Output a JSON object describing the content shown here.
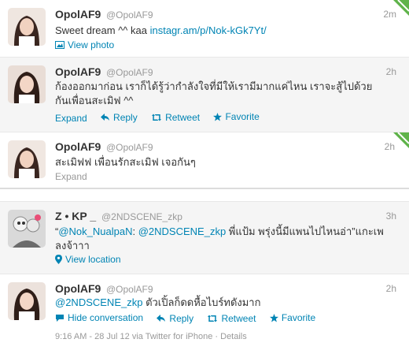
{
  "tweets": [
    {
      "fullname": "OpolAF9",
      "screenname": "@OpolAF9",
      "time": "2m",
      "text": "Sweet dream ^^ kaa ",
      "link": "instagr.am/p/Nok-kGk7Yt/",
      "view_photo": "View photo"
    },
    {
      "fullname": "OpolAF9",
      "screenname": "@OpolAF9",
      "time": "2h",
      "text": "ก้องออกมาก่อน เราก็ได้รู้ว่ากำลังใจที่มีให้เรามีมากแค่ไหน เราจะสู้ไปด้วยกันเพื่อนสะเมิฟ ^^",
      "expand": "Expand",
      "reply": "Reply",
      "retweet": "Retweet",
      "favorite": "Favorite"
    },
    {
      "fullname": "OpolAF9",
      "screenname": "@OpolAF9",
      "time": "2h",
      "text": "สะเมิฟฟ เพื่อนรักสะเมิฟ เจอกันๆ",
      "expand": "Expand"
    },
    {
      "fullname": "Z • KP _ ",
      "screenname": "@2NDSCENE_zkp",
      "time": "3h",
      "quote_open": "“",
      "mention1": "@Nok_NualpaN",
      "colon": ": ",
      "mention2": "@2NDSCENE_zkp",
      "text_rest": " พี่แป้ม พรุ่งนี้มีแพนไปไหนอ่า”แกะเพลงจ้าาา",
      "view_location": "View location"
    },
    {
      "fullname": "OpolAF9",
      "screenname": "@OpolAF9",
      "time": "2h",
      "mention": "@2NDSCENE_zkp",
      "text_rest": " ตัวเปิ้ลก็ดดหื้อไบร์ทดังมาก",
      "hide": "Hide conversation",
      "reply": "Reply",
      "retweet": "Retweet",
      "favorite": "Favorite",
      "meta": "9:16 AM - 28 Jul 12 via Twitter for iPhone · Details"
    }
  ],
  "colors": {
    "link": "#0084b4",
    "muted": "#999999",
    "corner_green": "#5fb34a"
  }
}
